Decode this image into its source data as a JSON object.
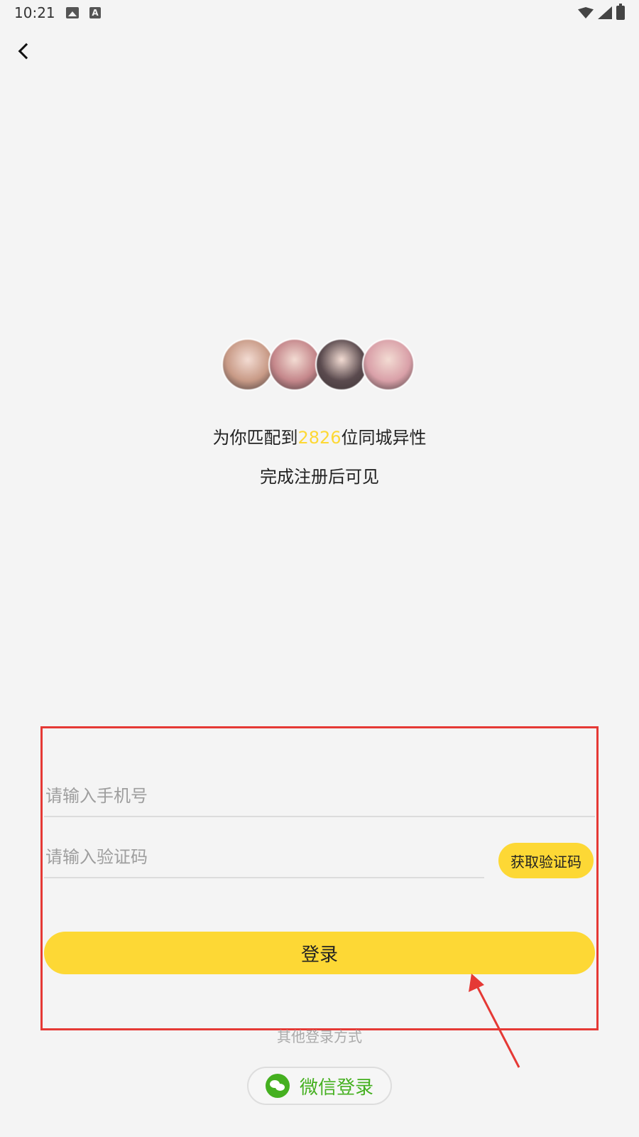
{
  "status_bar": {
    "time": "10:21",
    "icons": [
      "image-icon",
      "a-icon",
      "wifi-icon",
      "signal-icon",
      "battery-icon"
    ]
  },
  "nav": {
    "back_icon": "chevron-left-icon"
  },
  "match": {
    "prefix": "为你匹配到",
    "count": "2826",
    "suffix": "位同城异性",
    "visible_text": "完成注册后可见",
    "count_color": "#fdd835"
  },
  "avatars": [
    {
      "color": "#c89a86"
    },
    {
      "color": "#c4868a"
    },
    {
      "color": "#5a4a4e"
    },
    {
      "color": "#d9a0a8"
    }
  ],
  "form": {
    "phone_placeholder": "请输入手机号",
    "phone_value": "",
    "code_placeholder": "请输入验证码",
    "code_value": "",
    "get_code_label": "获取验证码",
    "login_label": "登录"
  },
  "other_login": {
    "label": "其他登录方式",
    "wechat_label": "微信登录",
    "wechat_icon": "wechat-icon"
  },
  "colors": {
    "accent": "#fdd835",
    "wechat": "#45b020",
    "annotation": "#e53935"
  }
}
